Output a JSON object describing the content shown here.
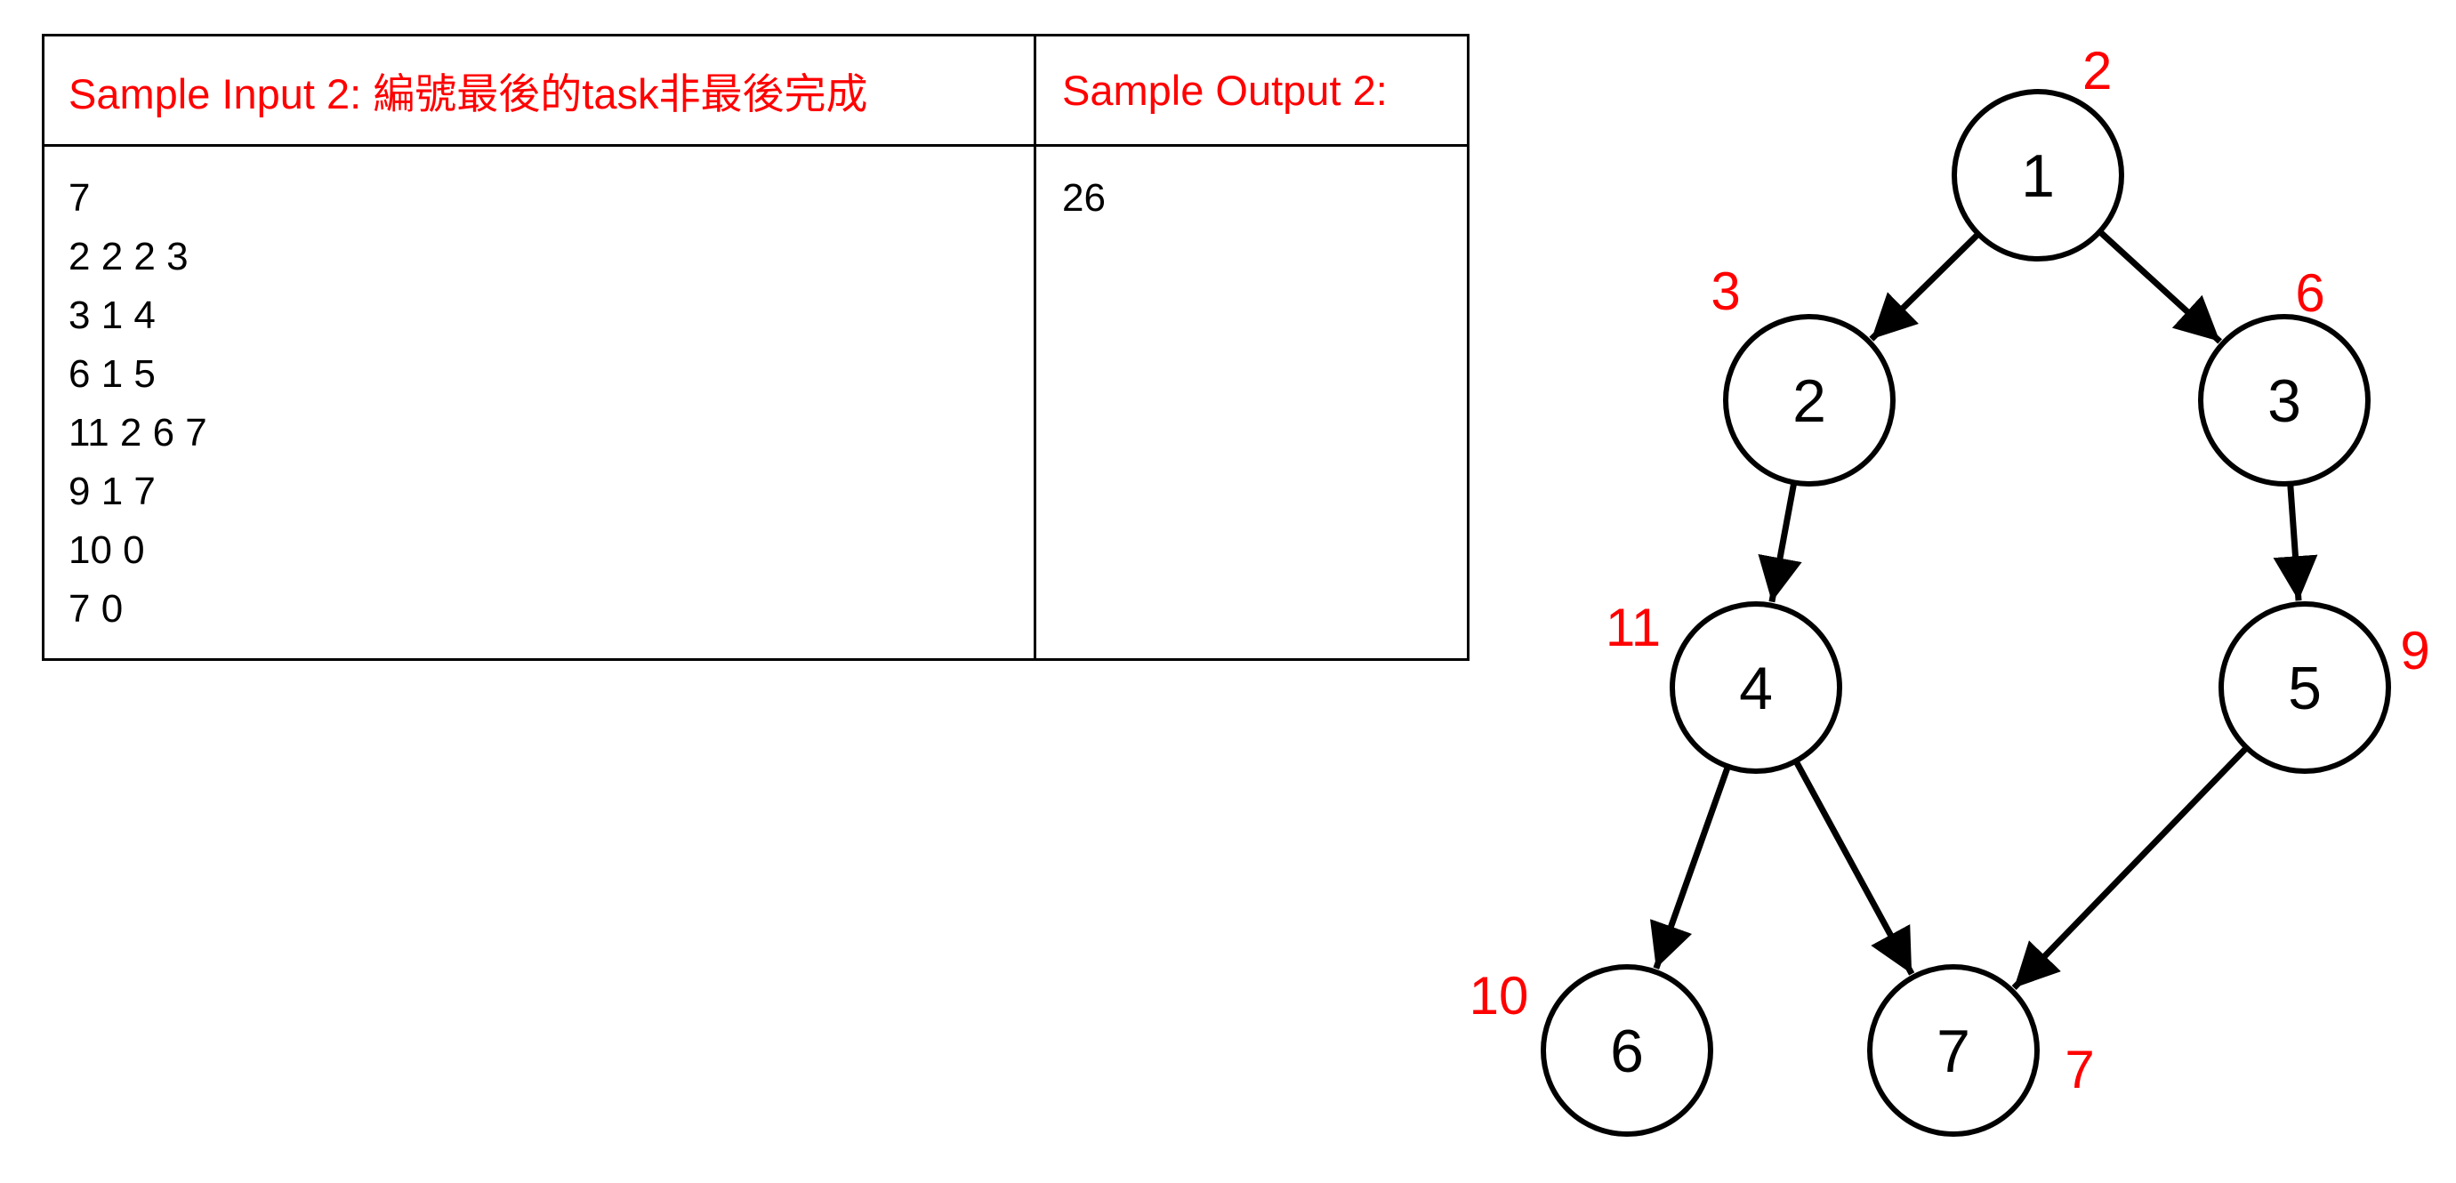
{
  "table": {
    "input_header": "Sample Input 2: 編號最後的task非最後完成",
    "output_header": "Sample Output 2:",
    "input_lines": [
      "7",
      "2 2 2 3",
      "3 1 4",
      "6 1 5",
      "11 2 6 7",
      "9 1 7",
      "10 0",
      "7 0"
    ],
    "output_lines": [
      "26"
    ]
  },
  "graph": {
    "colors": {
      "weight": "#ff0000",
      "node": "#000000"
    },
    "nodes": [
      {
        "id": "1",
        "weight": "2"
      },
      {
        "id": "2",
        "weight": "3"
      },
      {
        "id": "3",
        "weight": "6"
      },
      {
        "id": "4",
        "weight": "11"
      },
      {
        "id": "5",
        "weight": "9"
      },
      {
        "id": "6",
        "weight": "10"
      },
      {
        "id": "7",
        "weight": "7"
      }
    ],
    "edges": [
      {
        "from": "1",
        "to": "2"
      },
      {
        "from": "1",
        "to": "3"
      },
      {
        "from": "2",
        "to": "4"
      },
      {
        "from": "3",
        "to": "5"
      },
      {
        "from": "4",
        "to": "6"
      },
      {
        "from": "4",
        "to": "7"
      },
      {
        "from": "5",
        "to": "7"
      }
    ]
  }
}
